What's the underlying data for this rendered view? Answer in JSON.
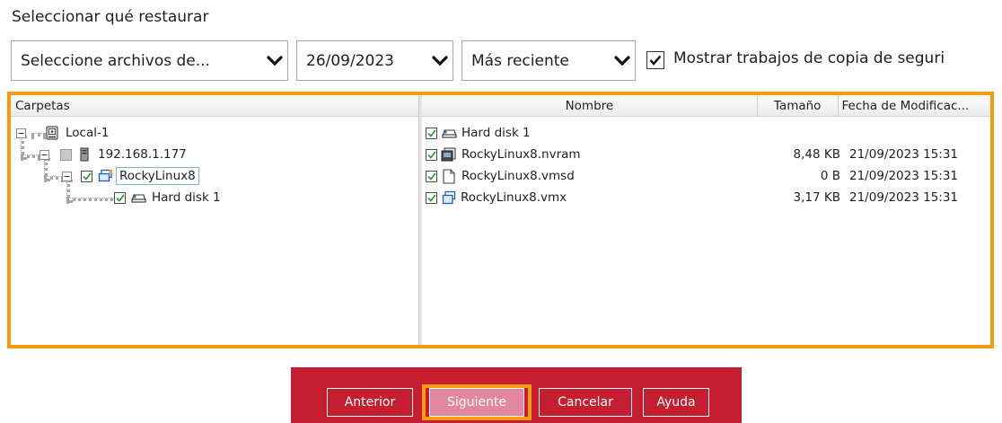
{
  "title": "Seleccionar qué restaurar",
  "filters": {
    "source": "Seleccione archivos de...",
    "date": "26/09/2023",
    "version": "Más reciente",
    "show_jobs_label": "Mostrar trabajos de copia de seguri",
    "show_jobs_checked": true
  },
  "tree": {
    "header": "Carpetas",
    "nodes": [
      {
        "label": "Local-1"
      },
      {
        "label": "192.168.1.177"
      },
      {
        "label": "RockyLinux8"
      },
      {
        "label": "Hard disk 1"
      }
    ]
  },
  "files": {
    "columns": {
      "name": "Nombre",
      "size": "Tamaño",
      "modified": "Fecha de Modificac..."
    },
    "rows": [
      {
        "name": "Hard disk 1",
        "size": "",
        "modified": ""
      },
      {
        "name": "RockyLinux8.nvram",
        "size": "8,48 KB",
        "modified": "21/09/2023 15:31"
      },
      {
        "name": "RockyLinux8.vmsd",
        "size": "0 B",
        "modified": "21/09/2023 15:31"
      },
      {
        "name": "RockyLinux8.vmx",
        "size": "3,17 KB",
        "modified": "21/09/2023 15:31"
      }
    ]
  },
  "buttons": {
    "back": "Anterior",
    "next": "Siguiente",
    "cancel": "Cancelar",
    "help": "Ayuda"
  },
  "colors": {
    "highlight": "#f79a10",
    "footer": "#c41e30",
    "active_button": "#e387a0"
  }
}
